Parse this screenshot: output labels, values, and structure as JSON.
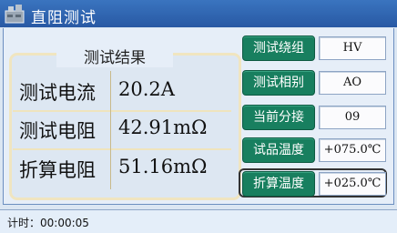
{
  "window": {
    "title": "直阻测试"
  },
  "result": {
    "title": "测试结果",
    "rows": [
      {
        "label": "测试电流",
        "value": "20.2A"
      },
      {
        "label": "测试电阻",
        "value": "42.91mΩ"
      },
      {
        "label": "折算电阻",
        "value": "51.16mΩ"
      }
    ]
  },
  "params": [
    {
      "button": "测试绕组",
      "value": "HV"
    },
    {
      "button": "测试相别",
      "value": "AO"
    },
    {
      "button": "当前分接",
      "value": "09"
    },
    {
      "button": "试品温度",
      "value": "+075.0℃"
    },
    {
      "button": "折算温度",
      "value": "+025.0℃"
    }
  ],
  "status": {
    "timer": "计时：00:00:05"
  },
  "colors": {
    "titlebar": "#2f65b0",
    "button": "#187f5f",
    "background": "#dbe6f2"
  }
}
